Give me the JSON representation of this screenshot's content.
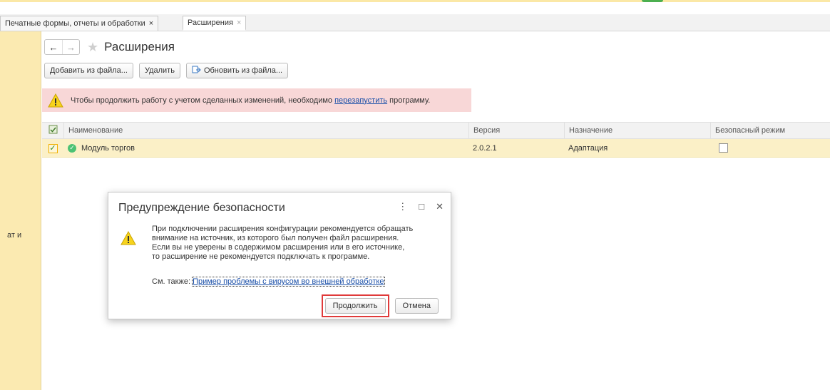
{
  "tabs": [
    {
      "label": "Печатные формы, отчеты и обработки",
      "close": "×"
    },
    {
      "label": "Расширения",
      "close": "×"
    }
  ],
  "left_panel": {
    "cut_text": "ат и"
  },
  "page": {
    "title": "Расширения",
    "back": "←",
    "forward": "→",
    "star": "★"
  },
  "toolbar": {
    "add_label": "Добавить из файла...",
    "delete_label": "Удалить",
    "update_label": "Обновить из файла..."
  },
  "warning": {
    "text_before": "Чтобы продолжить работу с учетом сделанных изменений, необходимо ",
    "link": "перезапустить",
    "text_after": " программу."
  },
  "table": {
    "columns": [
      "Наименование",
      "Версия",
      "Назначение",
      "Безопасный режим"
    ],
    "rows": [
      {
        "name": "Модуль торгов",
        "version": "2.0.2.1",
        "purpose": "Адаптация",
        "safe_mode": false,
        "active": true
      }
    ]
  },
  "dialog": {
    "title": "Предупреждение безопасности",
    "menu": "⋮",
    "maximize": "□",
    "close": "✕",
    "message_lines": [
      "При подключении расширения конфигурации рекомендуется обращать",
      "внимание на источник, из которого был получен файл расширения.",
      "Если вы не уверены в содержимом расширения или в его источнике,",
      "то расширение не рекомендуется подключать к программе."
    ],
    "see_also_label": "См. также: ",
    "see_also_link": "Пример проблемы с вирусом во внешней обработке",
    "continue_label": "Продолжить",
    "cancel_label": "Отмена"
  },
  "colors": {
    "accent_yellow": "#fbeab1",
    "warning_bg": "#f8d7d7",
    "highlight_red": "#e03a3a",
    "link_blue": "#1a4fa8"
  }
}
